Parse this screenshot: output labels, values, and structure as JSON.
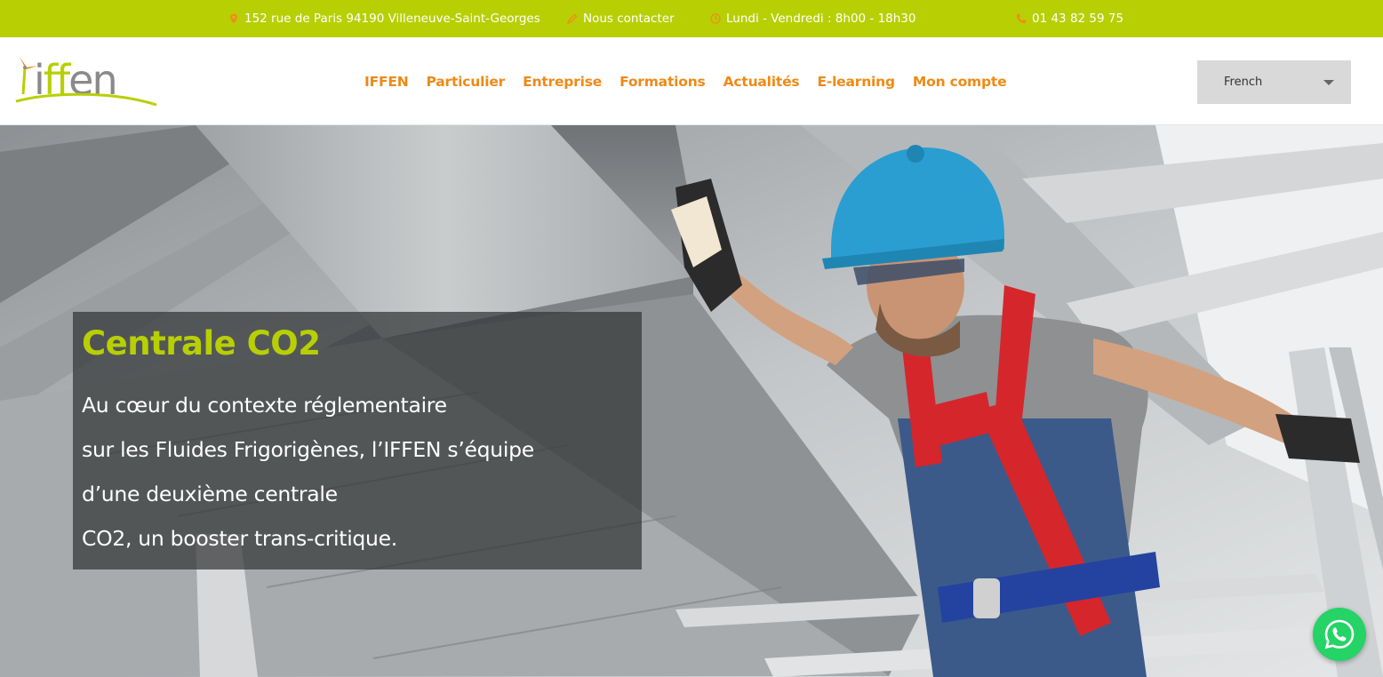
{
  "topbar": {
    "address": "152 rue de Paris 94190 Villeneuve-Saint-Georges",
    "contact": "Nous contacter",
    "hours": "Lundi - Vendredi : 8h00 - 18h30",
    "phone": "01 43 82 59 75",
    "icons": [
      "map-pin-icon",
      "pencil-icon",
      "clock-icon",
      "phone-icon"
    ]
  },
  "brand": {
    "logo_text": "iffen",
    "logo_parts": [
      "i",
      "ff",
      "en"
    ]
  },
  "nav": {
    "items": [
      "IFFEN",
      "Particulier",
      "Entreprise",
      "Formations",
      "Actualités",
      "E-learning",
      "Mon compte"
    ]
  },
  "language": {
    "selected": "French"
  },
  "hero": {
    "title": "Centrale CO2",
    "lines": [
      "Au cœur du contexte réglementaire",
      "sur les Fluides Frigorigènes, l’IFFEN s’équipe",
      "d’une deuxième centrale",
      "CO2, un booster trans-critique."
    ]
  },
  "colors": {
    "brand_green": "#b8cf04",
    "nav_orange": "#ee8a16",
    "icon_orange": "#f28c1c",
    "whatsapp_green": "#25d366"
  }
}
